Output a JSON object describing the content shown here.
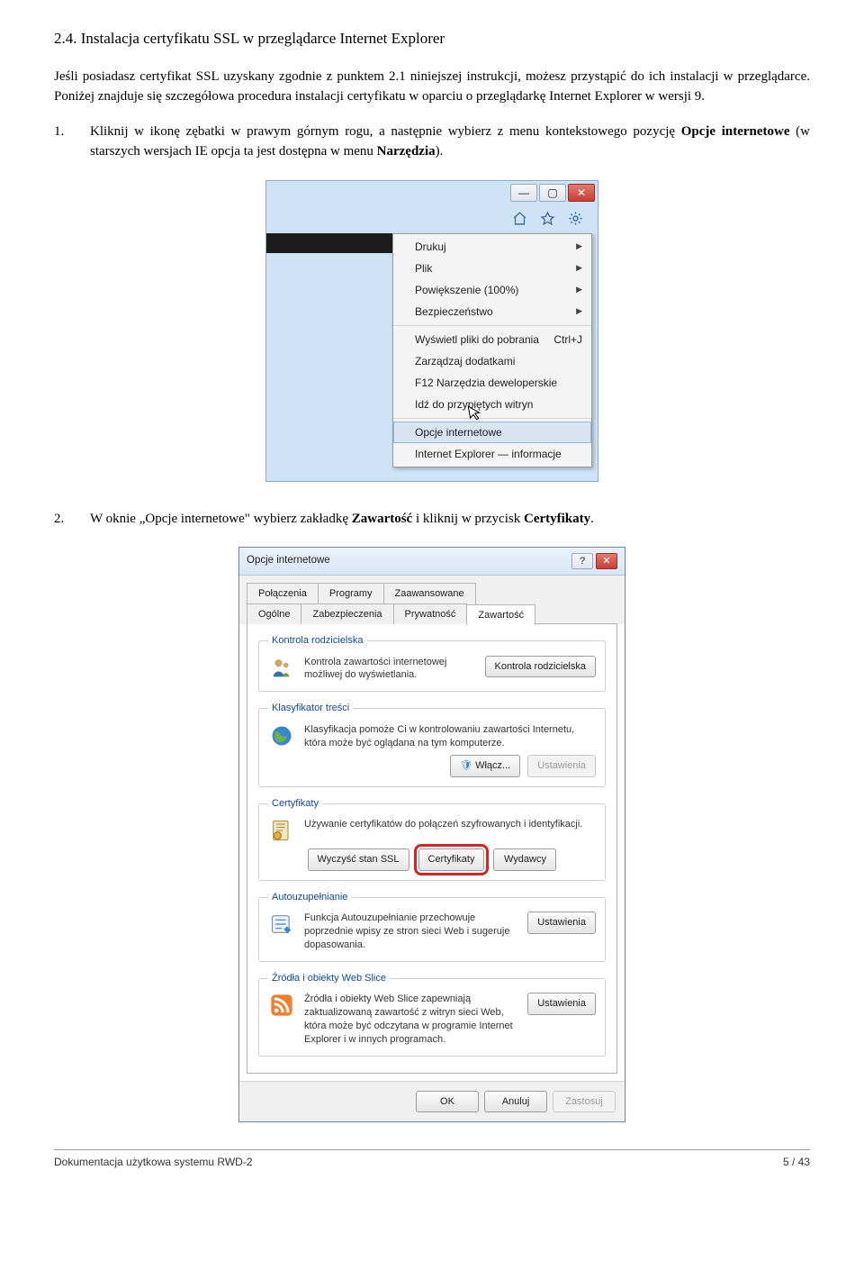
{
  "heading": "2.4. Instalacja certyfikatu SSL w przeglądarce Internet Explorer",
  "para1": "Jeśli posiadasz certyfikat SSL uzyskany zgodnie z punktem 2.1 niniejszej instrukcji, możesz przystąpić do ich instalacji w przeglądarce. Poniżej znajduje się szczegółowa procedura instalacji certyfikatu w oparciu o przeglądarkę Internet Explorer w wersji 9.",
  "step1_num": "1.",
  "step1_a": "Kliknij w ikonę zębatki w prawym górnym rogu, a następnie wybierz z menu kontekstowego pozycję ",
  "step1_b": "Opcje internetowe",
  "step1_c": " (w starszych wersjach IE opcja ta jest dostępna w menu ",
  "step1_d": "Narzędzia",
  "step1_e": ").",
  "step2_num": "2.",
  "step2_a": "W oknie „Opcje internetowe\" wybierz zakładkę ",
  "step2_b": "Zawartość",
  "step2_c": " i kliknij w przycisk ",
  "step2_d": "Certyfikaty",
  "step2_e": ".",
  "menu": {
    "drukuj": "Drukuj",
    "plik": "Plik",
    "pow": "Powiększenie (100%)",
    "bezp": "Bezpieczeństwo",
    "pobrania": "Wyświetl pliki do pobrania",
    "ctrlj": "Ctrl+J",
    "dodatki": "Zarządzaj dodatkami",
    "f12": "F12 Narzędzia deweloperskie",
    "przyp": "Idź do przypiętych witryn",
    "opcje": "Opcje internetowe",
    "info": "Internet Explorer — informacje"
  },
  "dialog": {
    "title": "Opcje internetowe",
    "tabs": {
      "polaczenia": "Połączenia",
      "programy": "Programy",
      "zaaw": "Zaawansowane",
      "ogolne": "Ogólne",
      "zabezp": "Zabezpieczenia",
      "pryw": "Prywatność",
      "zaw": "Zawartość"
    },
    "sec1": {
      "legend": "Kontrola rodzicielska",
      "txt": "Kontrola zawartości internetowej możliwej do wyświetlania.",
      "btn": "Kontrola rodzicielska"
    },
    "sec2": {
      "legend": "Klasyfikator treści",
      "txt": "Klasyfikacja pomoże Ci w kontrolowaniu zawartości Internetu, która może być oglądana na tym komputerze.",
      "btn1": "Włącz...",
      "btn2": "Ustawienia"
    },
    "sec3": {
      "legend": "Certyfikaty",
      "txt": "Używanie certyfikatów do połączeń szyfrowanych i identyfikacji.",
      "b1": "Wyczyść stan SSL",
      "b2": "Certyfikaty",
      "b3": "Wydawcy"
    },
    "sec4": {
      "legend": "Autouzupełnianie",
      "txt": "Funkcja Autouzupełnianie przechowuje poprzednie wpisy ze stron sieci Web i sugeruje dopasowania.",
      "btn": "Ustawienia"
    },
    "sec5": {
      "legend": "Źródła i obiekty Web Slice",
      "txt": "Źródła i obiekty Web Slice zapewniają zaktualizowaną zawartość z witryn sieci Web, która może być odczytana w programie Internet Explorer i w innych programach.",
      "btn": "Ustawienia"
    },
    "ok": "OK",
    "anuluj": "Anuluj",
    "zastosuj": "Zastosuj"
  },
  "footer": {
    "left": "Dokumentacja użytkowa systemu RWD-2",
    "right": "5 / 43"
  }
}
